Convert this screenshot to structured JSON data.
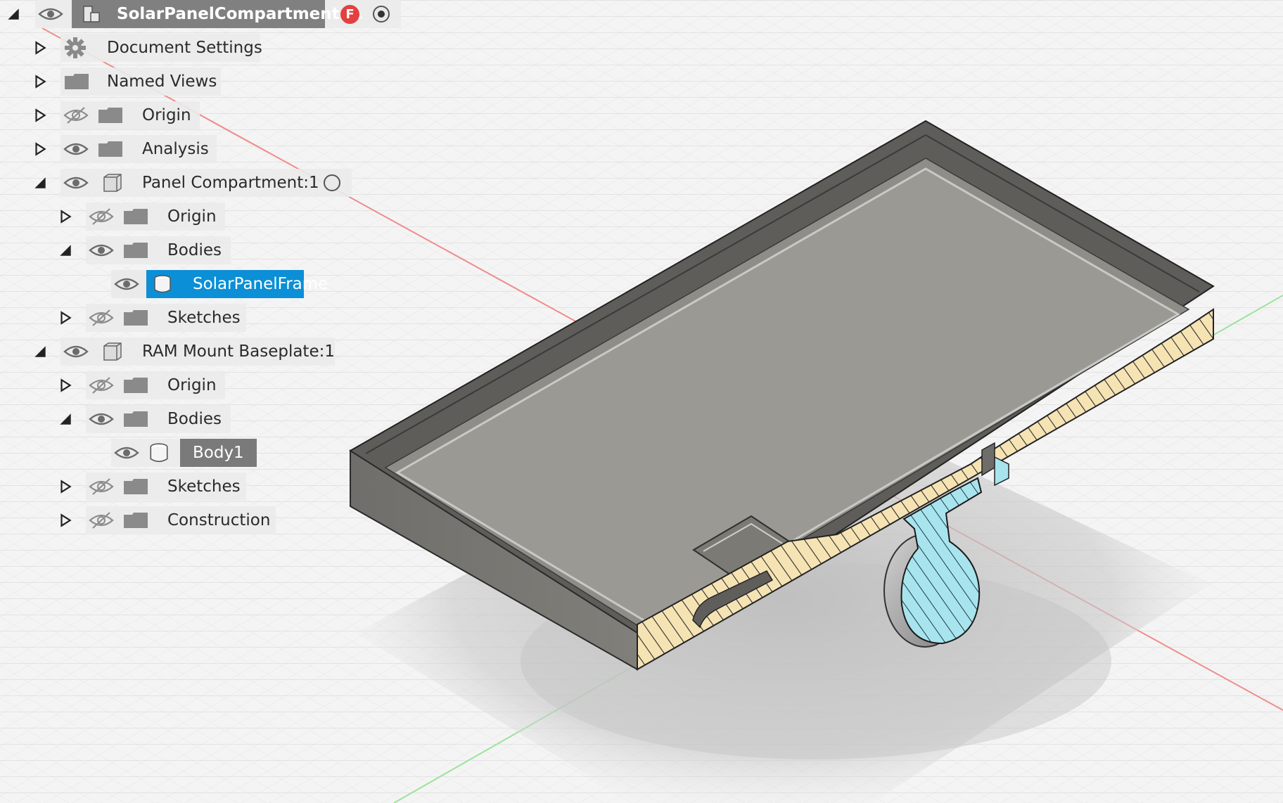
{
  "app": {
    "accent": "#0b8fd6",
    "component_badge_color": "#e34040"
  },
  "browser": {
    "root": {
      "label": "SolarPanelCompartment ...",
      "badge": "F"
    },
    "items": [
      {
        "label": "Document Settings"
      },
      {
        "label": "Named Views"
      },
      {
        "label": "Origin"
      },
      {
        "label": "Analysis"
      },
      {
        "label": "Panel Compartment:1"
      },
      {
        "label": "Origin"
      },
      {
        "label": "Bodies"
      },
      {
        "label": "SolarPanelFrame"
      },
      {
        "label": "Sketches"
      },
      {
        "label": "RAM Mount Baseplate:1"
      },
      {
        "label": "Origin"
      },
      {
        "label": "Bodies"
      },
      {
        "label": "Body1"
      },
      {
        "label": "Sketches"
      },
      {
        "label": "Construction"
      }
    ]
  },
  "viewport": {
    "model_colors": {
      "body": "#7d7c78",
      "section_fill": "#f6e3b4",
      "mount_section": "#a8e4ee",
      "floor": "#9a9892"
    }
  }
}
